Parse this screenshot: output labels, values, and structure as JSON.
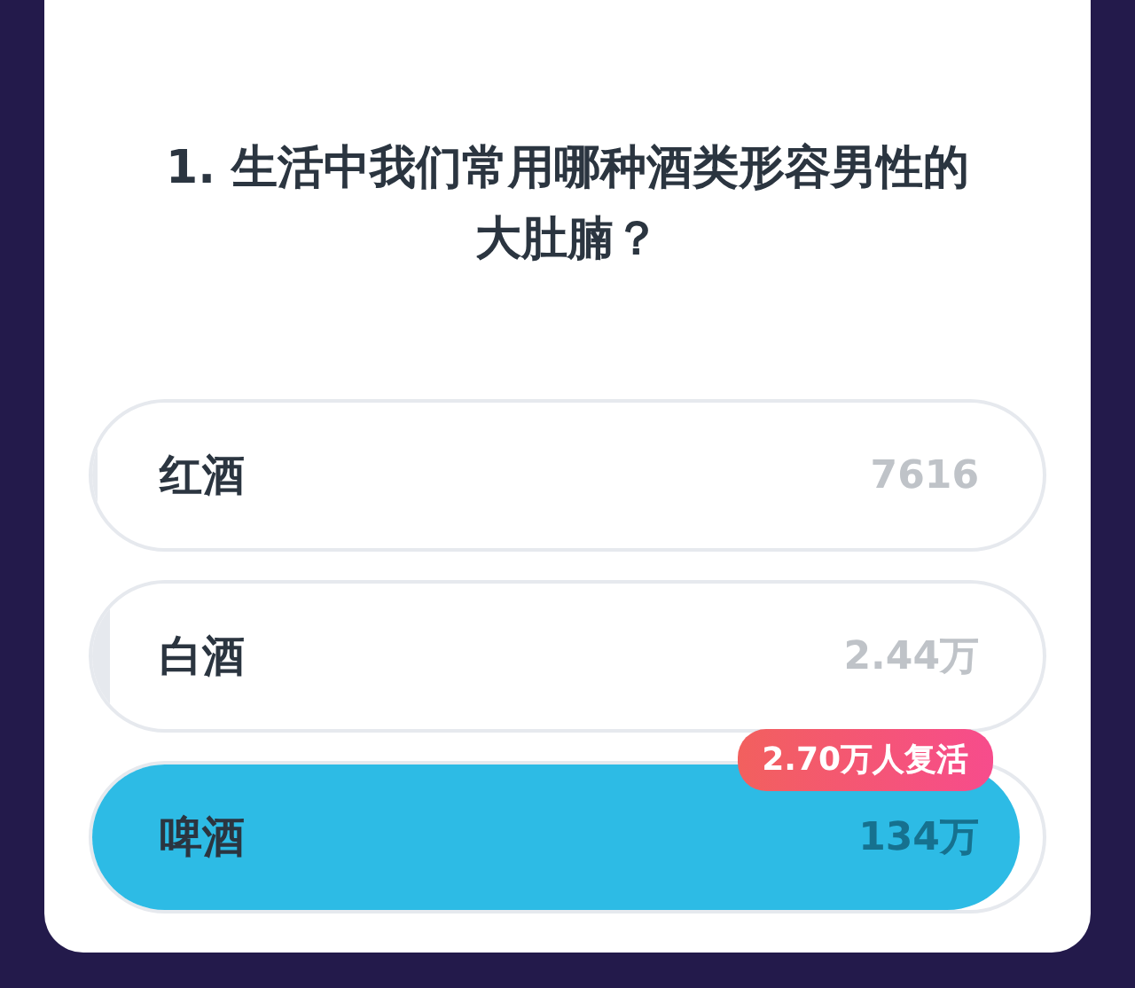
{
  "question": "1. 生活中我们常用哪种酒类形容男性的大肚腩？",
  "options": [
    {
      "label": "红酒",
      "count": "7616",
      "level": 0.005,
      "correct": false
    },
    {
      "label": "白酒",
      "count": "2.44万",
      "level": 0.018,
      "correct": false
    },
    {
      "label": "啤酒",
      "count": "134万",
      "level": 0.975,
      "correct": true,
      "badge": "2.70万人复活"
    }
  ]
}
